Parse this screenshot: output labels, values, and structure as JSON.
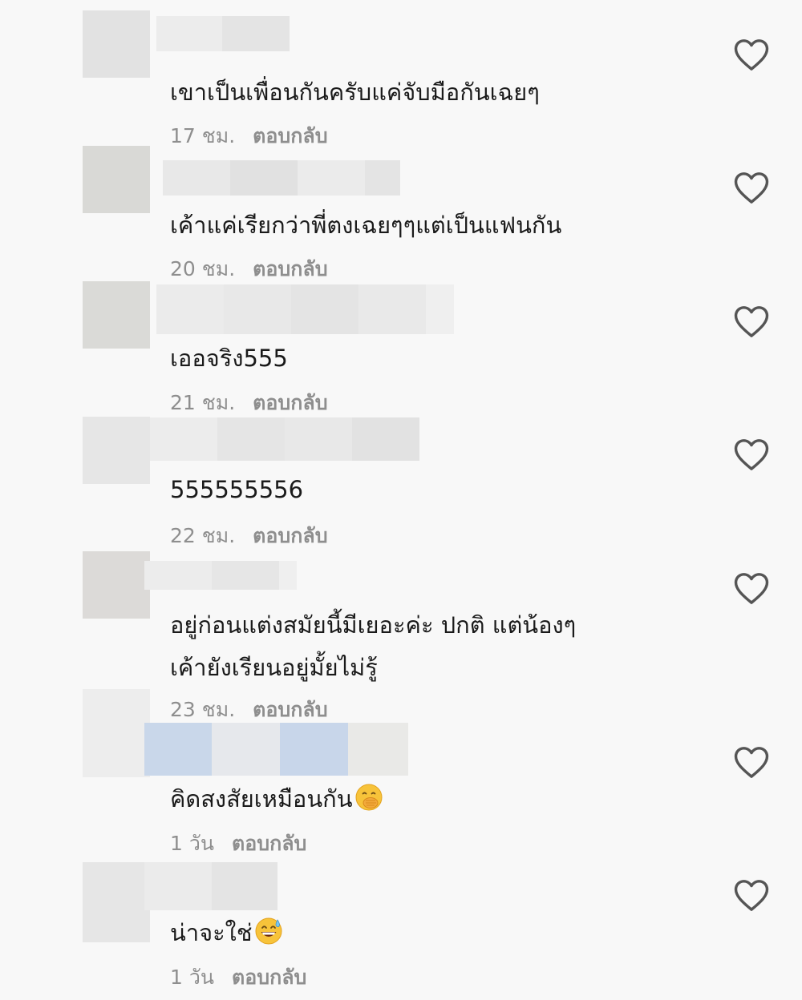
{
  "comments": [
    {
      "text": "เขาเป็นเพื่อนกันครับแค่จับมือกันเฉยๆ",
      "time": "17 ชม.",
      "reply": "ตอบกลับ"
    },
    {
      "text": "เค้าแค่เรียกว่าพี่ตงเฉยๆๆแต่เป็นแฟนกัน",
      "time": "20 ชม.",
      "reply": "ตอบกลับ"
    },
    {
      "text": "เออจริง555",
      "time": "21 ชม.",
      "reply": "ตอบกลับ"
    },
    {
      "text": "555555556",
      "time": "22 ชม.",
      "reply": "ตอบกลับ"
    },
    {
      "text_line1": "อยู่ก่อนแต่งสมัยนี้มีเยอะค่ะ ปกติ แต่น้องๆ",
      "text_line2": "เค้ายังเรียนอยู่มั้ยไม่รู้",
      "time": "23 ชม.",
      "reply": "ตอบกลับ"
    },
    {
      "text": "คิดสงสัยเหมือนกัน",
      "emoji": "face-with-hand-over-mouth",
      "time": "1 วัน",
      "reply": "ตอบกลับ"
    },
    {
      "text": "น่าจะใช่",
      "emoji": "grinning-face-with-sweat",
      "time": "1 วัน",
      "reply": "ตอบกลับ"
    }
  ],
  "icons": {
    "like": "heart-outline-icon"
  },
  "colors": {
    "background": "#f8f8f8",
    "text": "#1a1a1a",
    "meta": "#8e8e8e",
    "heart_stroke": "#555555"
  }
}
